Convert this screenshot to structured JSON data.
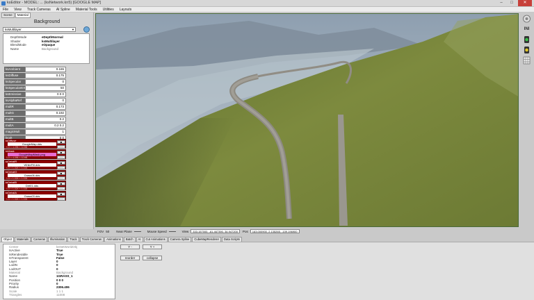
{
  "window": {
    "title": "ksEditor - MODEL: ... (ksNetwork.kn5) [GOOGLE MAP]",
    "min": "–",
    "max": "□",
    "close": "✕"
  },
  "menu": [
    "File",
    "View",
    "Track Cameras",
    "AI Spline",
    "Material Tools",
    "Utilities",
    "Layouts"
  ],
  "left_tabs": [
    "Scene",
    "Material"
  ],
  "panel": {
    "heading": "Background",
    "shader": "ksMultilayer",
    "props": [
      {
        "k": "DepthMode",
        "v": "eDepthNormal"
      },
      {
        "k": "Shader",
        "v": "ksMultilayer"
      },
      {
        "k": "BlendMode",
        "v": "eOpaque"
      },
      {
        "k": "Name",
        "v": "Background",
        "muted": true
      }
    ],
    "material_vars": [
      {
        "k": "ksAmbient",
        "v": "0.165"
      },
      {
        "k": "ksDiffuse",
        "v": "0.175"
      },
      {
        "k": "ksSpecular",
        "v": "0"
      },
      {
        "k": "ksSpecularEXP",
        "v": "50"
      },
      {
        "k": "ksEmissive",
        "v": "0 0 0"
      },
      {
        "k": "ksAlphaRef",
        "v": "0"
      },
      {
        "k": "multR",
        "v": "0.173"
      },
      {
        "k": "multG",
        "v": "0.192"
      },
      {
        "k": "multB",
        "v": "0.2"
      },
      {
        "k": "multA",
        "v": "0.2 0.2"
      },
      {
        "k": "magicMult",
        "v": "1"
      },
      {
        "k": "bcolt",
        "v": "0 0"
      }
    ],
    "textures": [
      {
        "slot": "txDiffuse",
        "file": "GoogleMap.dds",
        "size": "1.0 × 4.096 × 4.096",
        "pink": false
      },
      {
        "slot": "txMask",
        "file": "GoogleMapMask.png",
        "size": "1.0 × 4.096 × 4.096",
        "pink": true
      },
      {
        "slot": "txDetailR",
        "file": "WhiteFill.dds",
        "size": "1.0 × 1.024 × 1.024",
        "pink": false
      },
      {
        "slot": "txDetailG",
        "file": "Grass06.dds",
        "size": "1.0 × 1.024 × 1.024",
        "pink": false
      },
      {
        "slot": "txDetailB",
        "file": "Dirt01.dds",
        "size": "1.0 × 1.024 × 1.024",
        "pink": false
      },
      {
        "slot": "txDetailA",
        "file": "Grass03.dds",
        "size": "1.0 × 1.024 × 1.024",
        "pink": false
      }
    ],
    "tex_btn_top": "■",
    "tex_btn_bottom": "···"
  },
  "status": {
    "fov_label": "FOV",
    "fov": "50",
    "near_label": "Near Plane",
    "speed_label": "Mouse Speed",
    "view_label": "View",
    "view_value": "333.157000, -61.467390, 34.947200",
    "pos_label": "Pos",
    "pos_value": "163.000900, 2.135265, -109.196900"
  },
  "bottom_tabs": [
    "Object",
    "Materials",
    "Cameras",
    "Illumination",
    "Track",
    "Track Cameras",
    "Animations",
    "Batch",
    "AI",
    "Cut Animations",
    "Camera Spline",
    "CubeMapRenderer",
    "Data Scripts"
  ],
  "object_props": [
    {
      "k": "Center",
      "v": "ksNetWorldObj",
      "muted": true
    },
    {
      "k": "IsActive",
      "v": "True"
    },
    {
      "k": "IsRenderable",
      "v": "True"
    },
    {
      "k": "IsTransparent",
      "v": "False"
    },
    {
      "k": "Layer",
      "v": "0"
    },
    {
      "k": "LodIN",
      "v": "0"
    },
    {
      "k": "LodOUT",
      "v": "0"
    },
    {
      "k": "Material",
      "v": "Background",
      "muted": true
    },
    {
      "k": "Name",
      "v": "1GRASS_1"
    },
    {
      "k": "Position",
      "v": "0 0 0"
    },
    {
      "k": "Priority",
      "v": "0"
    },
    {
      "k": "Radius",
      "v": "2306.406"
    },
    {
      "k": "Scale",
      "v": "1 1 1",
      "muted": true
    },
    {
      "k": "Triangles",
      "v": "11008",
      "muted": true
    }
  ],
  "bottom_buttons": {
    "y_minus": "Y -",
    "y_plus": "Y +",
    "reorder": "reorder",
    "collapse": "collapse"
  },
  "tools": {
    "icons": [
      "gear-sphere-icon",
      "ini-icon",
      "green-light-icon",
      "yellow-light-icon",
      "grid-icon"
    ],
    "ini_label": "INI"
  },
  "colors": {
    "texture_slot": "#8b0000",
    "texture_pink": "#e96cd1",
    "var_label": "#6c6c6c",
    "grass": "#7a8a3c",
    "road": "#8d8a82"
  }
}
